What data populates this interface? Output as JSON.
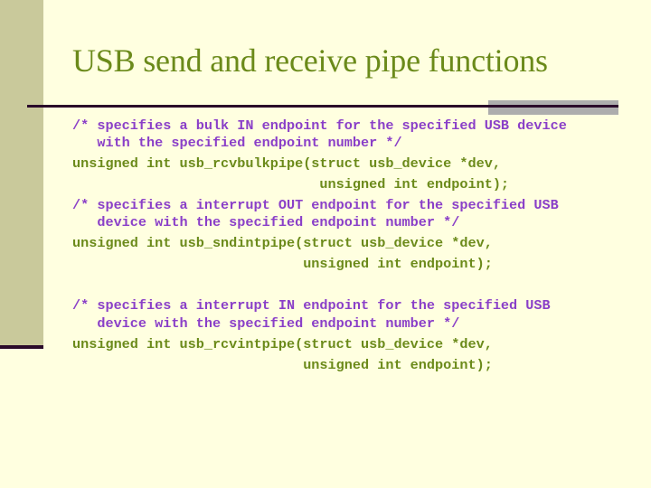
{
  "slide": {
    "title": "USB send and receive pipe functions",
    "colors": {
      "background": "#ffffe0",
      "sidebar": "#c9c99b",
      "rule": "#2a0a2a",
      "rule_accent": "#adadad",
      "title": "#6b8a1a",
      "comment": "#8a3fc8",
      "declaration": "#6b8a1a"
    },
    "code_blocks": [
      {
        "comment": [
          "/* specifies a bulk IN endpoint for the specified USB device",
          "   with the specified endpoint number */"
        ],
        "declaration": [
          "unsigned int usb_rcvbulkpipe(struct usb_device *dev,",
          "                              unsigned int endpoint);"
        ]
      },
      {
        "comment": [
          "/* specifies a interrupt OUT endpoint for the specified USB",
          "   device with the specified endpoint number */"
        ],
        "declaration": [
          "unsigned int usb_sndintpipe(struct usb_device *dev,",
          "                            unsigned int endpoint);"
        ]
      },
      {
        "comment": [
          "/* specifies a interrupt IN endpoint for the specified USB",
          "   device with the specified endpoint number */"
        ],
        "declaration": [
          "unsigned int usb_rcvintpipe(struct usb_device *dev,",
          "                            unsigned int endpoint);"
        ]
      }
    ]
  }
}
